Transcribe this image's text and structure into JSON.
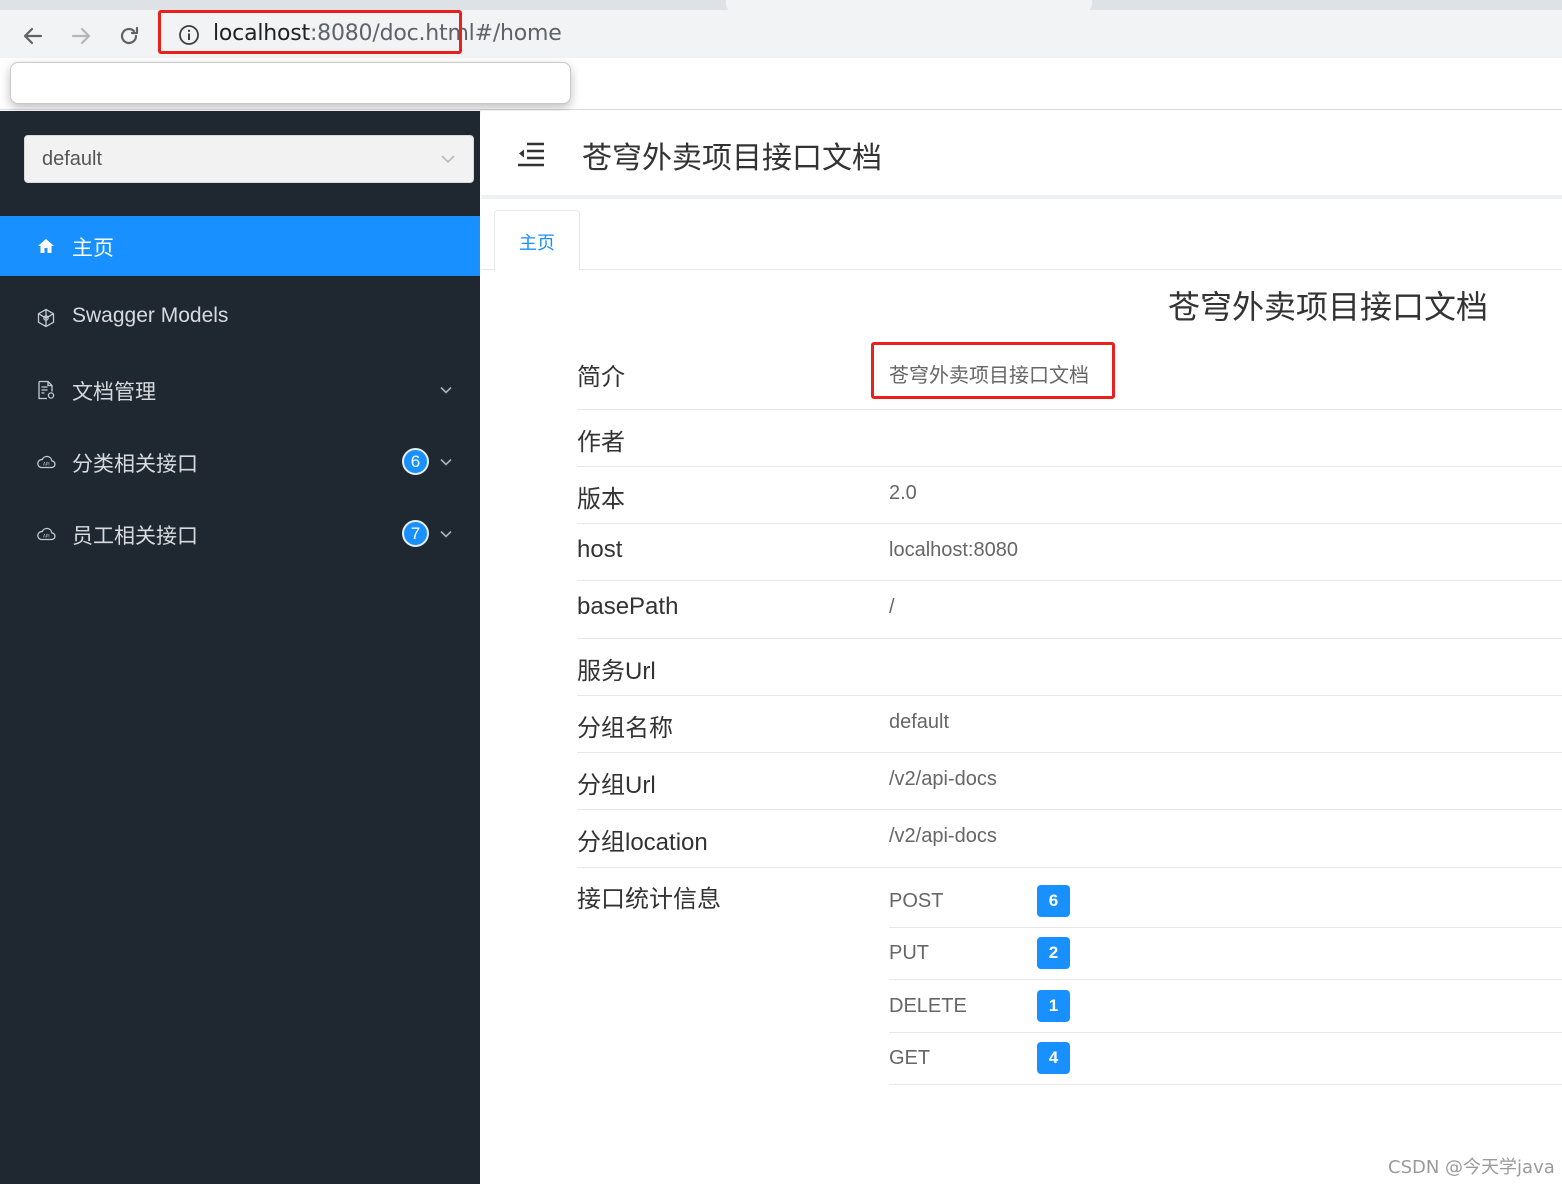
{
  "browser": {
    "url_host": "localhost",
    "url_rest_bold": ":8080/doc.html",
    "url_hash": "#/home"
  },
  "sidebar": {
    "group_select_value": "default",
    "items": [
      {
        "label": "主页",
        "icon": "home-icon",
        "active": true
      },
      {
        "label": "Swagger Models",
        "icon": "cube-icon"
      },
      {
        "label": "文档管理",
        "icon": "document-settings-icon"
      },
      {
        "label": "分类相关接口",
        "icon": "api-cloud-icon",
        "badge": "6"
      },
      {
        "label": "员工相关接口",
        "icon": "api-cloud-icon",
        "badge": "7"
      }
    ]
  },
  "header": {
    "title": "苍穹外卖项目接口文档"
  },
  "tabs": [
    {
      "label": "主页"
    }
  ],
  "home": {
    "title": "苍穹外卖项目接口文档",
    "rows": [
      {
        "key": "简介",
        "value": "苍穹外卖项目接口文档"
      },
      {
        "key": "作者",
        "value": ""
      },
      {
        "key": "版本",
        "value": "2.0"
      },
      {
        "key": "host",
        "value": "localhost:8080"
      },
      {
        "key": "basePath",
        "value": "/"
      },
      {
        "key": "服务Url",
        "value": ""
      },
      {
        "key": "分组名称",
        "value": "default"
      },
      {
        "key": "分组Url",
        "value": "/v2/api-docs"
      },
      {
        "key": "分组location",
        "value": "/v2/api-docs"
      }
    ],
    "stats_label": "接口统计信息",
    "stats": [
      {
        "method": "POST",
        "count": "6"
      },
      {
        "method": "PUT",
        "count": "2"
      },
      {
        "method": "DELETE",
        "count": "1"
      },
      {
        "method": "GET",
        "count": "4"
      }
    ]
  },
  "watermark": "CSDN @今天学java",
  "colors": {
    "sidebar_bg": "#1f2831",
    "accent": "#1890ff",
    "annotation_red": "#e8211d"
  }
}
